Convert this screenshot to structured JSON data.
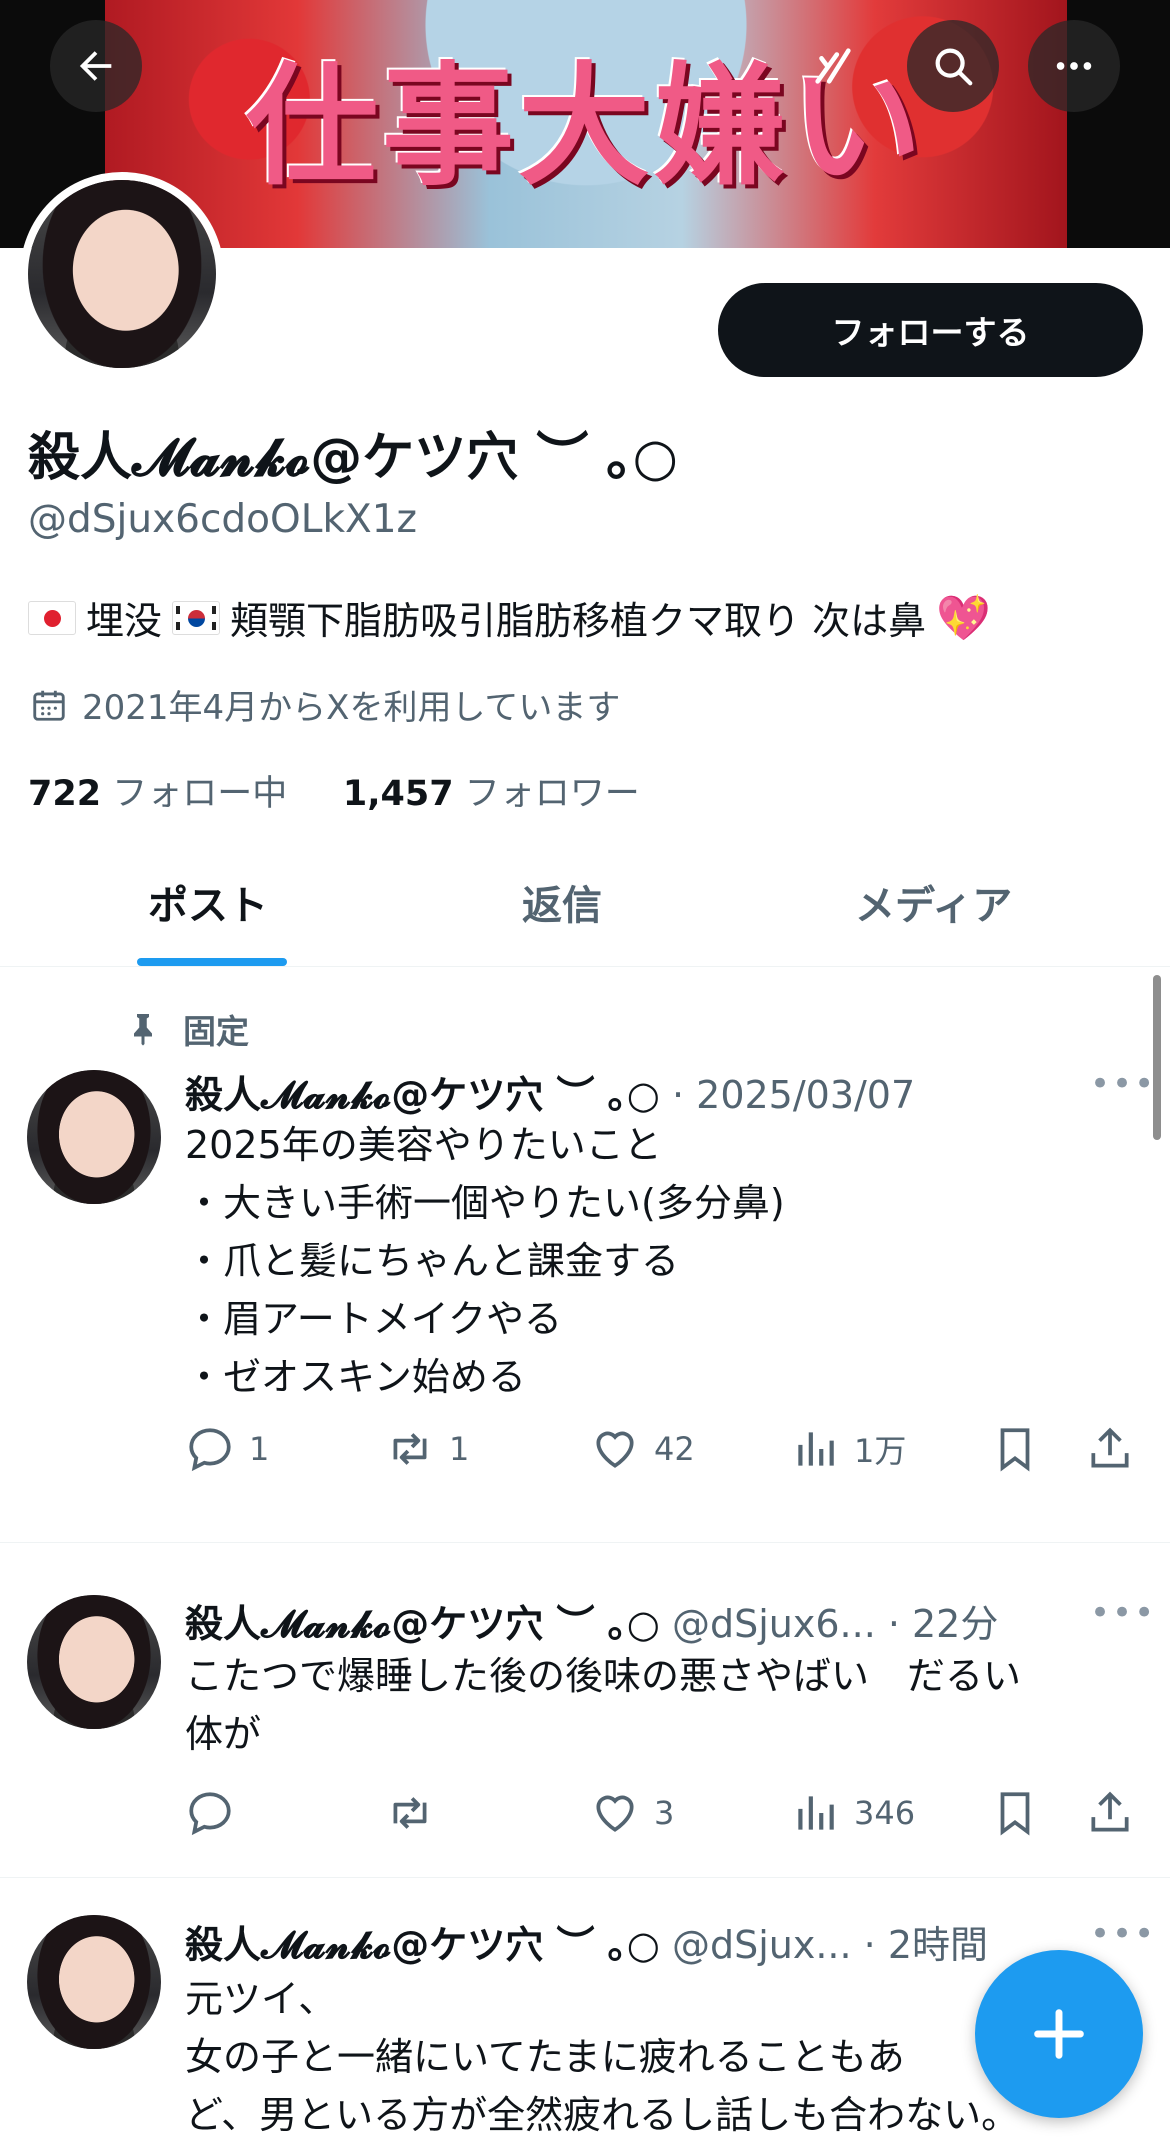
{
  "banner": {
    "text": "仕事大嫌い"
  },
  "profile": {
    "follow_label": "フォローする",
    "display_name": "殺人𝓜𝓪𝓷𝓴𝓸@ケツ穴 ︶ ｡○",
    "handle": "@dSjux6cdoOLkX1z",
    "bio_part1": "埋没",
    "bio_part2": "頬顎下脂肪吸引脂肪移植クマ取り 次は鼻",
    "bio_emoji": "💖",
    "joined": "2021年4月からXを利用しています",
    "following_count": "722",
    "following_label": "フォロー中",
    "followers_count": "1,457",
    "followers_label": "フォロワー"
  },
  "tabs": [
    {
      "label": "ポスト"
    },
    {
      "label": "返信"
    },
    {
      "label": "メディア"
    }
  ],
  "pinned_label": "固定",
  "posts": [
    {
      "name": "殺人𝓜𝓪𝓷𝓴𝓸@ケツ穴 ︶ ｡○",
      "meta": "· 2025/03/07",
      "lines": [
        "2025年の美容やりたいこと",
        "・大きい手術一個やりたい(多分鼻)",
        "・爪と髪にちゃんと課金する",
        "・眉アートメイクやる",
        "・ゼオスキン始める"
      ],
      "replies": "1",
      "reposts": "1",
      "likes": "42",
      "views": "1万"
    },
    {
      "name": "殺人𝓜𝓪𝓷𝓴𝓸@ケツ穴 ︶ ｡○",
      "meta": "@dSjux6... · 22分",
      "lines": [
        "こたつで爆睡した後の後味の悪さやばい　だるい",
        "体が"
      ],
      "replies": "",
      "reposts": "",
      "likes": "3",
      "views": "346"
    },
    {
      "name": "殺人𝓜𝓪𝓷𝓴𝓸@ケツ穴 ︶ ｡○",
      "meta": "@dSjux... · 2時間",
      "lines": [
        "元ツイ、",
        "女の子と一緒にいてたまに疲れることもあ",
        "ど、男といる方が全然疲れるし話しも合わない。"
      ]
    }
  ],
  "colors": {
    "accent": "#1d9bf0",
    "text": "#0f1419",
    "muted": "#536471"
  }
}
